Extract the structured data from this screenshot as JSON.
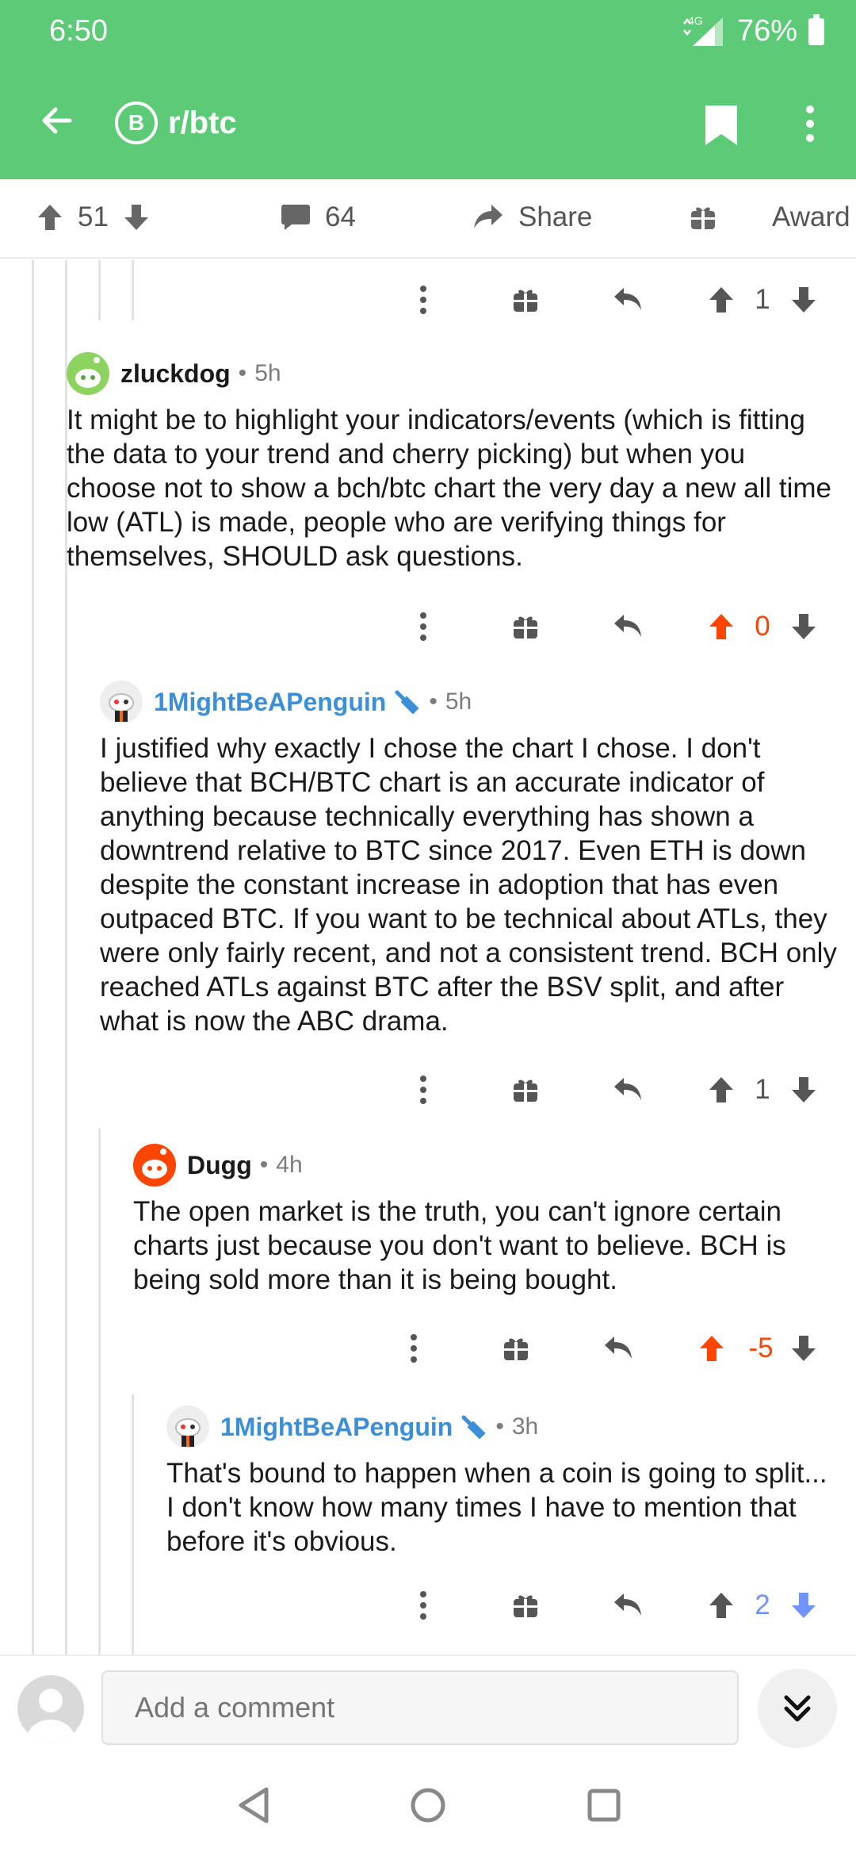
{
  "status": {
    "time": "6:50",
    "network": "4G",
    "battery": "76%"
  },
  "toolbar": {
    "subreddit": "r/btc",
    "badge_letter": "B"
  },
  "post_actions": {
    "votes": "51",
    "comments": "64",
    "share": "Share",
    "award": "Award"
  },
  "top_stub": {
    "score": "1"
  },
  "comments": [
    {
      "author": "zluckdog",
      "time": "5h",
      "body": "It might be to highlight your indicators/events (which is fitting the data to your trend and cherry picking) but when you choose not to show a bch/btc chart the very day a new all time low (ATL) is made, people who are verifying things for themselves, SHOULD ask questions.",
      "score": "0",
      "vote_state": "up"
    },
    {
      "author": "1MightBeAPenguin",
      "time": "5h",
      "body": "I justified why exactly I chose the chart I chose. I don't believe that BCH/BTC chart is an accurate indicator of anything because technically everything has shown a downtrend relative to BTC since 2017. Even ETH is down despite the constant increase in adoption that has even outpaced BTC. If you want to be technical about ATLs, they were only fairly recent, and not a consistent trend. BCH only reached ATLs against BTC after the BSV split, and after what is now the ABC drama.",
      "score": "1",
      "vote_state": "none"
    },
    {
      "author": "Dugg",
      "time": "4h",
      "body": "The open market is the truth, you can't ignore certain charts just because you don't want to believe. BCH is being sold more than it is being bought.",
      "score": "-5",
      "vote_state": "up"
    },
    {
      "author": "1MightBeAPenguin",
      "time": "3h",
      "body": "That's bound to happen when a coin is going to split... I don't know how many times I have to mention that before it's obvious.",
      "score": "2",
      "vote_state": "down"
    }
  ],
  "composer": {
    "placeholder": "Add a comment"
  },
  "colors": {
    "brand_green": "#5dca77",
    "upvote": "#ff4500",
    "downvote": "#7193ff",
    "mod_blue": "#3a8fd8"
  }
}
